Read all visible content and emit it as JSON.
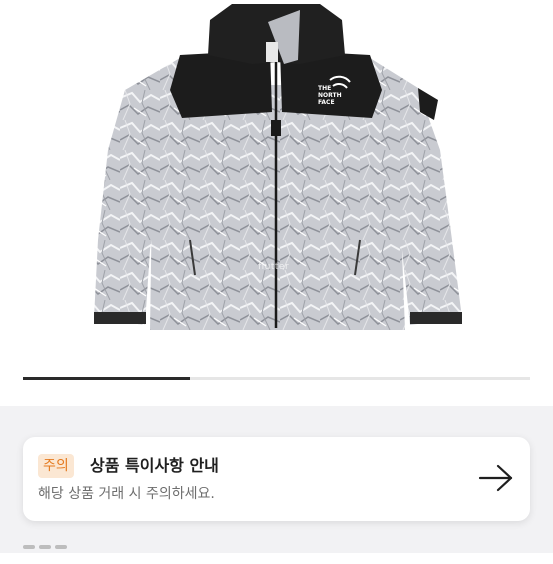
{
  "product_image": {
    "alt": "THE NORTH FACE",
    "logo_text": [
      "THE",
      "NORTH",
      "FACE"
    ],
    "watermark": "flutter"
  },
  "carousel": {
    "progress": 0.33
  },
  "notice": {
    "badge": "주의",
    "title": "상품 특이사항 안내",
    "description": "해당 상품 거래 시 주의하세요."
  },
  "colors": {
    "badge_bg": "#fbe7d3",
    "badge_text": "#e57a1f",
    "progress_fill": "#2a2a2a",
    "section_bg": "#f2f2f4"
  },
  "icons": {
    "notice_arrow": "arrow-right-icon"
  }
}
